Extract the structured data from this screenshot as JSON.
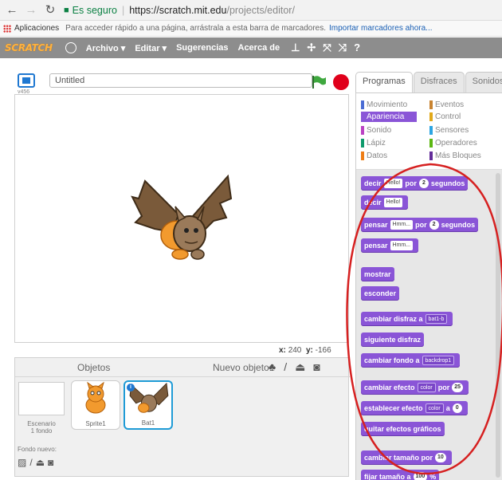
{
  "browser": {
    "secure_label": "Es seguro",
    "url_host": "https://scratch.mit.edu",
    "url_path": "/projects/editor/",
    "apps_label": "Aplicaciones",
    "bookmarks_hint": "Para acceder rápido a una página, arrástrala a esta barra de marcadores.",
    "import_link": "Importar marcadores ahora..."
  },
  "menubar": {
    "logo": "SCRATCH",
    "items": [
      "Archivo ▾",
      "Editar ▾",
      "Sugerencias",
      "Acerca de"
    ]
  },
  "stage": {
    "version": "v456",
    "title_value": "Untitled",
    "coord_x_label": "x:",
    "coord_x": "240",
    "coord_y_label": "y:",
    "coord_y": "-166"
  },
  "sprites": {
    "objects_label": "Objetos",
    "new_object_label": "Nuevo objeto:",
    "stage_label_1": "Escenario",
    "stage_label_2": "1 fondo",
    "backdrop_label": "Fondo nuevo:",
    "items": [
      {
        "name": "Sprite1"
      },
      {
        "name": "Bat1"
      }
    ]
  },
  "tabs": [
    "Programas",
    "Disfraces",
    "Sonidos"
  ],
  "categories": [
    {
      "label": "Movimiento",
      "color": "#4a6cd4"
    },
    {
      "label": "Eventos",
      "color": "#c88330"
    },
    {
      "label": "Apariencia",
      "color": "#8a55d7"
    },
    {
      "label": "Control",
      "color": "#e1a91a"
    },
    {
      "label": "Sonido",
      "color": "#bb42c3"
    },
    {
      "label": "Sensores",
      "color": "#2ca5e2"
    },
    {
      "label": "Lápiz",
      "color": "#0e9a6c"
    },
    {
      "label": "Operadores",
      "color": "#5cb712"
    },
    {
      "label": "Datos",
      "color": "#ee7d16"
    },
    {
      "label": "Más Bloques",
      "color": "#632d99"
    }
  ],
  "blocks": {
    "b1_a": "decir",
    "b1_slot": "Hello!",
    "b1_b": "por",
    "b1_num": "2",
    "b1_c": "segundos",
    "b2_a": "decir",
    "b2_slot": "Hello!",
    "b3_a": "pensar",
    "b3_slot": "Hmm...",
    "b3_b": "por",
    "b3_num": "2",
    "b3_c": "segundos",
    "b4_a": "pensar",
    "b4_slot": "Hmm...",
    "b5": "mostrar",
    "b6": "esconder",
    "b7_a": "cambiar disfraz a",
    "b7_slot": "bat1-b",
    "b8": "siguiente disfraz",
    "b9_a": "cambiar fondo a",
    "b9_slot": "backdrop1",
    "b10_a": "cambiar efecto",
    "b10_slot": "color",
    "b10_b": "por",
    "b10_num": "25",
    "b11_a": "establecer efecto",
    "b11_slot": "color",
    "b11_b": "a",
    "b11_num": "0",
    "b12": "quitar efectos gráficos",
    "b13_a": "cambiar tamaño por",
    "b13_num": "10",
    "b14_a": "fijar tamaño a",
    "b14_num": "100",
    "b14_b": "%"
  },
  "annotation_color": "#d62020"
}
